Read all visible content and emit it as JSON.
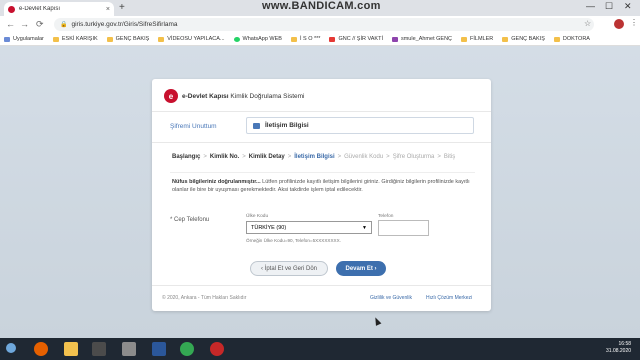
{
  "browser": {
    "tab_title": "e-Devlet Kapısı",
    "close_glyph": "×",
    "new_tab_glyph": "+",
    "url": "giris.turkiye.gov.tr/Giris/SifreSifirlama",
    "watermark": "www.BANDICAM.com",
    "window_controls": [
      "—",
      "☐",
      "✕"
    ],
    "nav": {
      "back": "←",
      "forward": "→",
      "reload": "⟳"
    },
    "lock_glyph": "🔒",
    "star_glyph": "☆",
    "menu_glyph": "⋮",
    "bookmarks": [
      {
        "label": "Uygulamalar",
        "icon": "grid"
      },
      {
        "label": "ESKİ KARIŞIK",
        "icon": "folder"
      },
      {
        "label": "GENÇ BAKIŞ",
        "icon": "folder"
      },
      {
        "label": "VİDEOSU YAPILACA...",
        "icon": "folder"
      },
      {
        "label": "WhatsApp WEB",
        "icon": "green"
      },
      {
        "label": "İ S O ***",
        "icon": "folder"
      },
      {
        "label": "GNC // ŞİR VAKTİ",
        "icon": "red"
      },
      {
        "label": "smule_Ahmet GENÇ",
        "icon": "purple"
      },
      {
        "label": "FİLMLER",
        "icon": "folder"
      },
      {
        "label": "GENÇ BAKIŞ",
        "icon": "folder"
      },
      {
        "label": "DOKTORA",
        "icon": "folder"
      }
    ]
  },
  "card": {
    "logo_mark": "e",
    "logo_brand": "e-Devlet Kapısı",
    "logo_sub": "Kimlik Doğrulama Sistemi",
    "section_label": "Şifremi Unuttum",
    "section_title": "İletişim Bilgisi",
    "steps": [
      {
        "label": "Başlangıç",
        "state": "done"
      },
      {
        "label": "Kimlik No.",
        "state": "done"
      },
      {
        "label": "Kimlik Detay",
        "state": "done"
      },
      {
        "label": "İletişim Bilgisi",
        "state": "active"
      },
      {
        "label": "Güvenlik Kodu",
        "state": "pending"
      },
      {
        "label": "Şifre Oluşturma",
        "state": "pending"
      },
      {
        "label": "Bitiş",
        "state": "pending"
      }
    ],
    "step_separator": ">",
    "info_bold": "Nüfus bilgileriniz doğrulanmıştır...",
    "info_text": " Lütfen profilinizde kayıtlı iletişim bilgilerini giriniz. Girdiğiniz bilgilerin profilinizde kayıtlı olanlar ile bire bir uyuşması gerekmektedir. Aksi takdirde işlem iptal edilecektir.",
    "phone_label": "* Cep Telefonu",
    "country_caption": "Ülke Kodu",
    "country_value": "TÜRKİYE (90)",
    "select_arrow": "▼",
    "phone_caption": "Telefon",
    "phone_value": "",
    "example": "Örneğin Ülke Kodu=90, Telefon=5XXXXXXXX.",
    "cancel_label": "‹ İptal Et ve Geri Dön",
    "next_label": "Devam Et ›",
    "footer_left": "© 2020, Ankara - Tüm Hakları Saklıdır",
    "footer_links": [
      "Gizlilik ve Güvenlik",
      "Hızlı Çözüm Merkezi"
    ]
  },
  "taskbar": {
    "time": "16:58",
    "date": "31.08.2020"
  }
}
